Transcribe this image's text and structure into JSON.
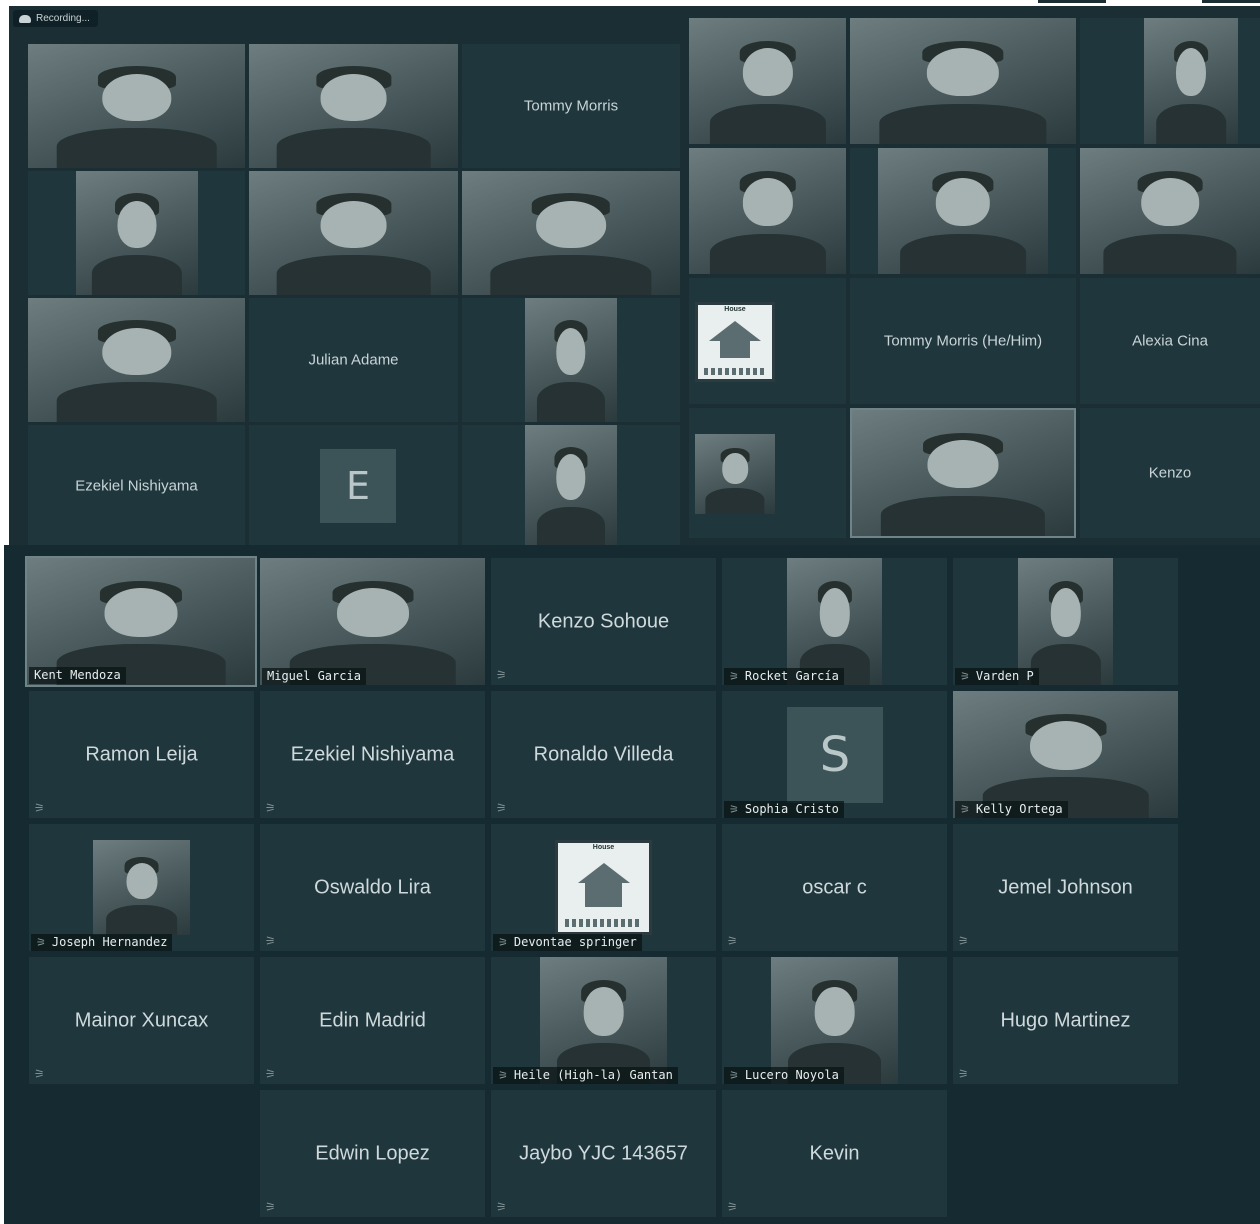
{
  "recording": {
    "text": "Recording..."
  },
  "panel_a": {
    "tiles": [
      {
        "type": "video",
        "desc_name": "video-outdoor-man"
      },
      {
        "type": "video",
        "desc_name": "video-man-cap"
      },
      {
        "type": "name",
        "name": "Tommy Morris"
      },
      {
        "type": "video",
        "desc_name": "video-man-suit"
      },
      {
        "type": "video",
        "desc_name": "video-woman"
      },
      {
        "type": "video",
        "desc_name": "video-woman-earbuds"
      },
      {
        "type": "video",
        "desc_name": "video-woman-nike"
      },
      {
        "type": "name",
        "name": "Julian Adame"
      },
      {
        "type": "video",
        "desc_name": "video-man-office"
      },
      {
        "type": "name",
        "name": "Ezekiel Nishiyama"
      },
      {
        "type": "letter",
        "letter": "E"
      },
      {
        "type": "video",
        "desc_name": "video-man-curly"
      }
    ]
  },
  "panel_b": {
    "tiles": [
      {
        "type": "video",
        "desc_name": "video-man-balcony"
      },
      {
        "type": "video",
        "desc_name": "video-man-hoodie"
      },
      {
        "type": "video",
        "desc_name": "video-man-room"
      },
      {
        "type": "video",
        "desc_name": "video-man-glasses"
      },
      {
        "type": "video",
        "desc_name": "video-man-ceiling"
      },
      {
        "type": "video",
        "desc_name": "video-man-wall"
      },
      {
        "type": "logo",
        "logo_caption": "House"
      },
      {
        "type": "name",
        "name": "Tommy Morris (He/Him)"
      },
      {
        "type": "name",
        "name": "Alexia Cina"
      },
      {
        "type": "video",
        "desc_name": "video-bridge"
      },
      {
        "type": "video",
        "desc_name": "video-man-speaking"
      },
      {
        "type": "name",
        "name": "Kenzo"
      }
    ]
  },
  "panel_c": {
    "tiles": [
      {
        "type": "video",
        "label": "Kent Mendoza",
        "muted": false
      },
      {
        "type": "video",
        "label": "Miguel Garcia",
        "muted": false
      },
      {
        "type": "name",
        "name": "Kenzo Sohoue",
        "muted": true
      },
      {
        "type": "video",
        "label": "Rocket García",
        "muted": true
      },
      {
        "type": "video",
        "label": "Varden P",
        "muted": true
      },
      {
        "type": "name",
        "name": "Ramon Leija",
        "muted": true
      },
      {
        "type": "name",
        "name": "Ezekiel Nishiyama",
        "muted": true
      },
      {
        "type": "name",
        "name": "Ronaldo Villeda",
        "muted": true
      },
      {
        "type": "letter",
        "letter": "S",
        "label": "Sophia Cristo",
        "muted": true
      },
      {
        "type": "video",
        "label": "Kelly Ortega",
        "muted": false
      },
      {
        "type": "video",
        "label": "Joseph Hernandez",
        "muted": true
      },
      {
        "type": "name",
        "name": "Oswaldo Lira",
        "muted": true
      },
      {
        "type": "logo",
        "logo_caption": "House",
        "label": "Devontae springer",
        "muted": true
      },
      {
        "type": "name",
        "name": "oscar c",
        "muted": true
      },
      {
        "type": "name",
        "name": "Jemel Johnson",
        "muted": true
      },
      {
        "type": "name",
        "name": "Mainor Xuncax",
        "muted": true
      },
      {
        "type": "name",
        "name": "Edin Madrid",
        "muted": true
      },
      {
        "type": "video",
        "label": "Heile (High-la) Gantan",
        "muted": true
      },
      {
        "type": "video",
        "label": "Lucero Noyola",
        "muted": true
      },
      {
        "type": "name",
        "name": "Hugo Martinez",
        "muted": true
      },
      {
        "type": "name",
        "name": "Edwin Lopez",
        "muted": true
      },
      {
        "type": "name",
        "name": "Jaybo YJC 143657",
        "muted": true
      },
      {
        "type": "name",
        "name": "Kevin",
        "muted": true
      }
    ]
  },
  "icons": {
    "mic_muted": "mic-muted-icon",
    "cloud": "cloud-icon"
  },
  "colors": {
    "panel_bg": "#1a2e33",
    "tile_bg": "#1f363c",
    "active_border": "#6f8489"
  }
}
